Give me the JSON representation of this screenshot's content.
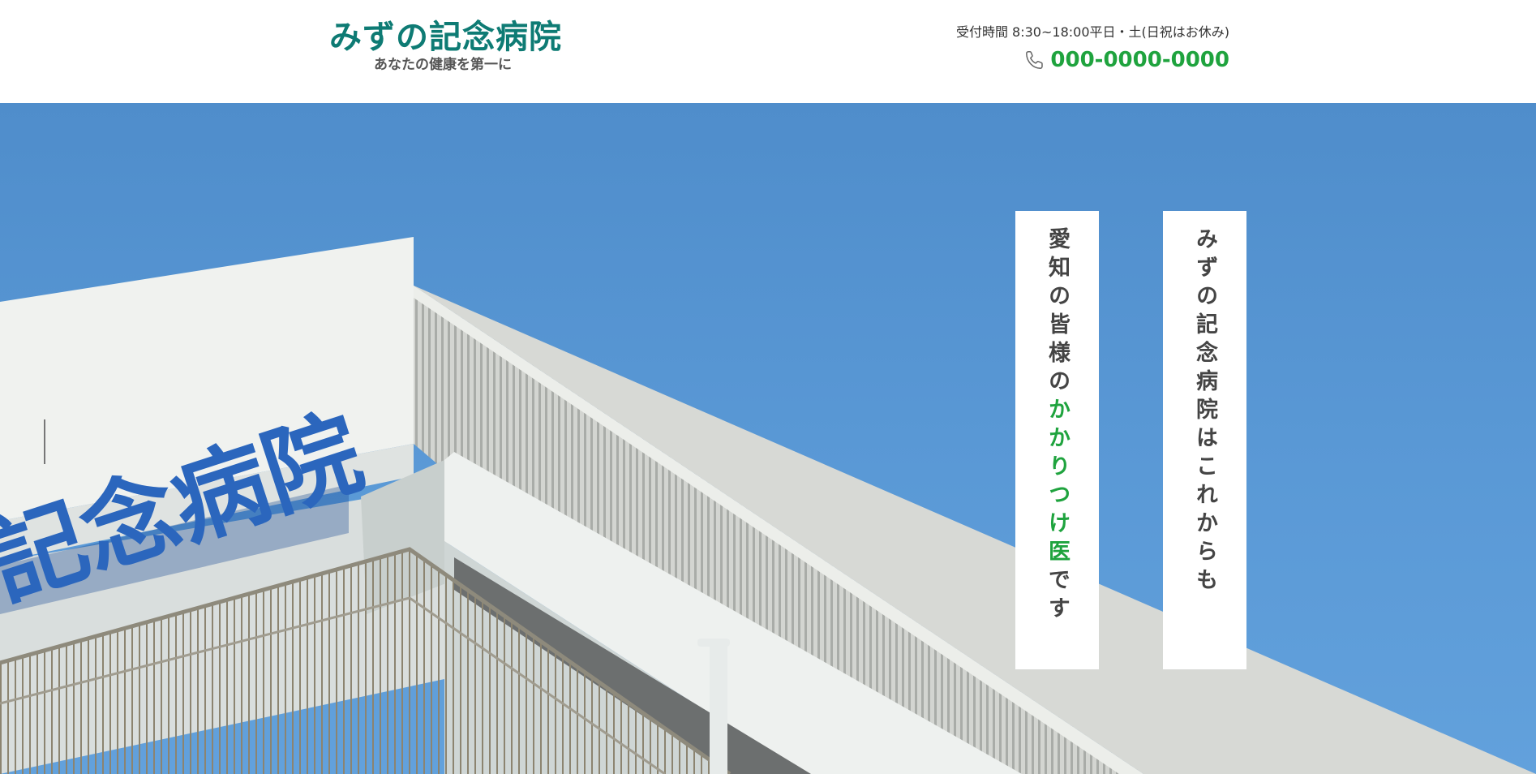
{
  "header": {
    "logo": {
      "title": "みずの記念病院",
      "tagline": "あなたの健康を第一に"
    },
    "contact": {
      "hours": "受付時間 8:30~18:00平日・土(日祝はお休み)",
      "phone_icon": "phone-icon",
      "phone": "000-0000-0000"
    }
  },
  "hero": {
    "photo": {
      "sign_text": "記念病院"
    },
    "catch_right": "みずの記念病院はこれからも",
    "catch_left": {
      "before": "愛知の皆様の",
      "accent": "かかりつけ医",
      "after": "です"
    }
  },
  "colors": {
    "brand_teal": "#0e7b74",
    "accent_green": "#1fa33e",
    "sky_blue": "#5a99d6",
    "text_dark": "#444444"
  }
}
